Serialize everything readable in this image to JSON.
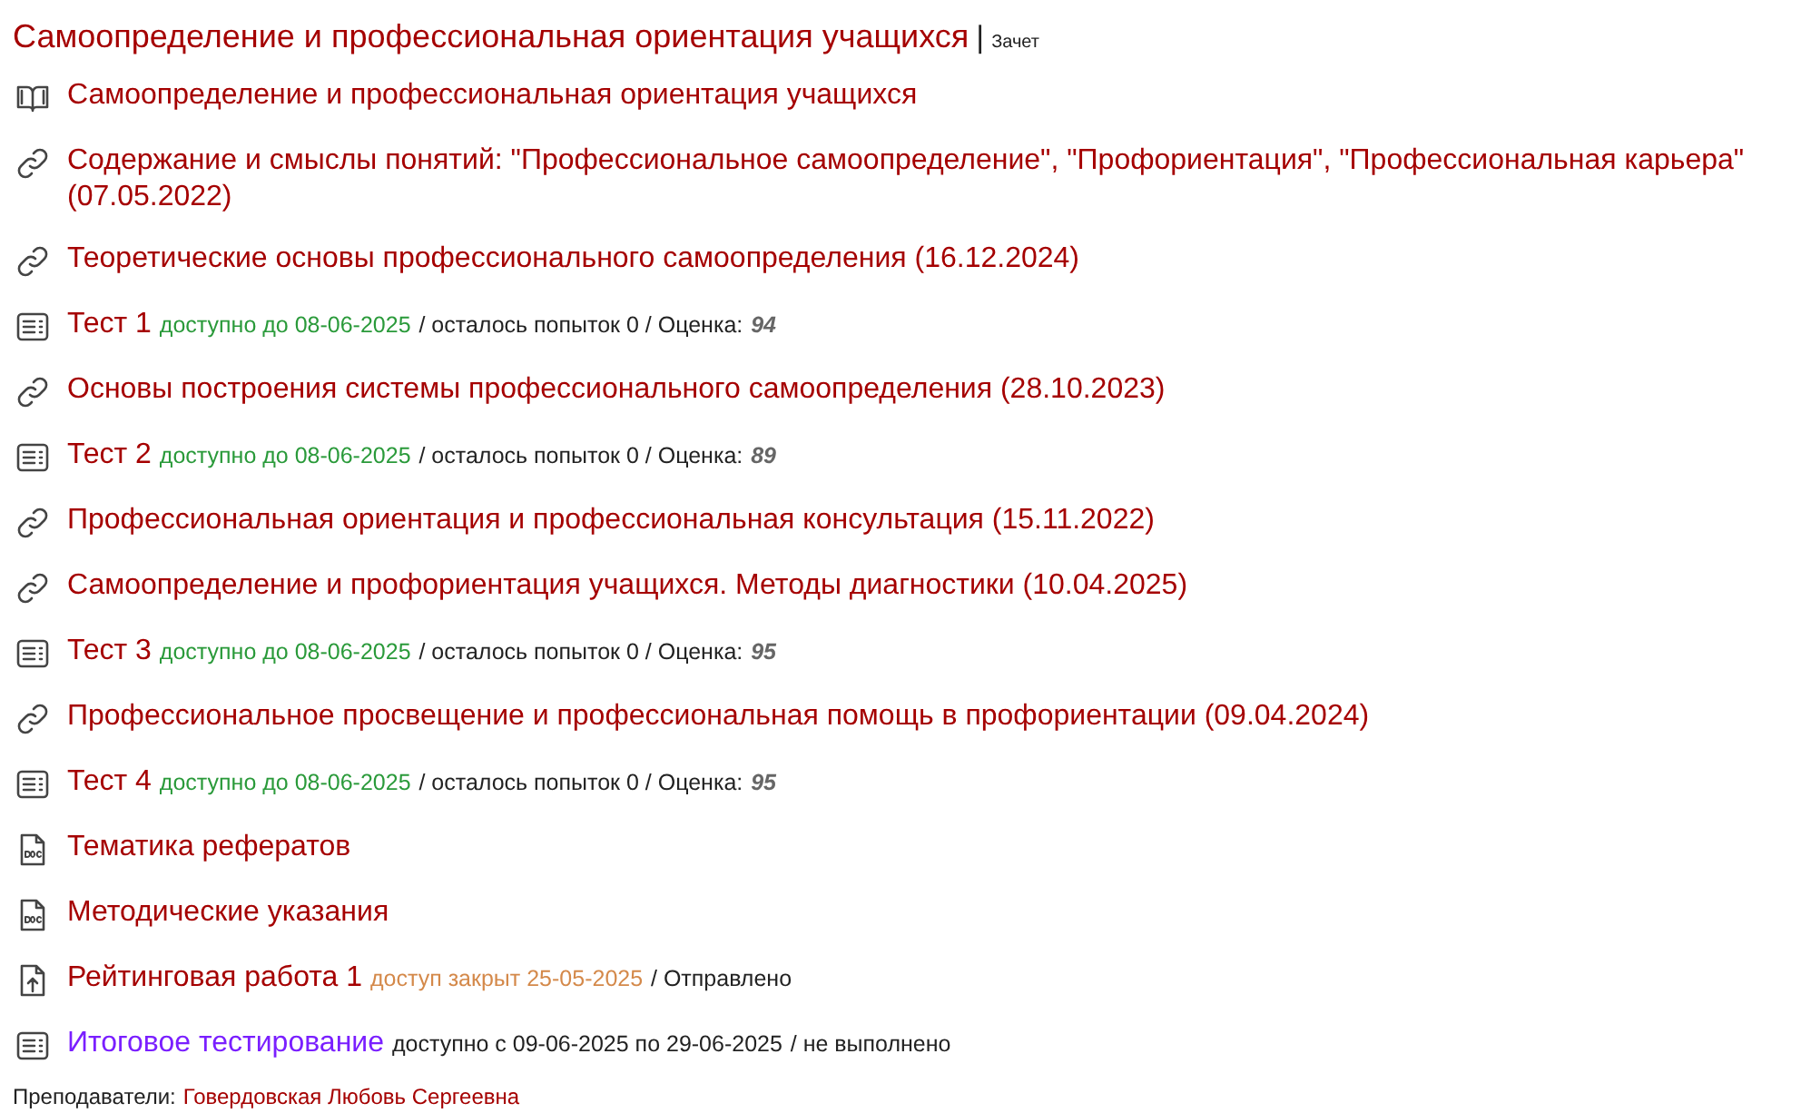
{
  "course": {
    "title": "Самоопределение и профессиональная ориентация учащихся",
    "separator": "|",
    "assessment": "Зачет"
  },
  "items": [
    {
      "kind": "book",
      "title": "Самоопределение и профессиональная ориентация учащихся",
      "color": "#a50000"
    },
    {
      "kind": "link",
      "title": "Содержание и смыслы понятий: \"Профессиональное самоопределение\", \"Профориентация\", \"Профессиональная карьера\" (07.05.2022)",
      "color": "#a50000"
    },
    {
      "kind": "link",
      "title": "Теоретические основы профессионального самоопределения (16.12.2024)",
      "color": "#a50000"
    },
    {
      "kind": "test",
      "title": "Тест 1",
      "color": "#a50000",
      "availability": {
        "kind": "open",
        "text": "доступно до 08-06-2025"
      },
      "details": "/ осталось попыток 0 / Оценка:",
      "grade": "94"
    },
    {
      "kind": "link",
      "title": "Основы построения системы профессионального самоопределения (28.10.2023)",
      "color": "#a50000"
    },
    {
      "kind": "test",
      "title": "Тест 2",
      "color": "#a50000",
      "availability": {
        "kind": "open",
        "text": "доступно до 08-06-2025"
      },
      "details": "/ осталось попыток 0 / Оценка:",
      "grade": "89"
    },
    {
      "kind": "link",
      "title": "Профессиональная ориентация и профессиональная консультация (15.11.2022)",
      "color": "#a50000"
    },
    {
      "kind": "link",
      "title": "Самоопределение и профориентация учащихся. Методы диагностики (10.04.2025)",
      "color": "#a50000"
    },
    {
      "kind": "test",
      "title": "Тест 3",
      "color": "#a50000",
      "availability": {
        "kind": "open",
        "text": "доступно до 08-06-2025"
      },
      "details": "/ осталось попыток 0 / Оценка:",
      "grade": "95"
    },
    {
      "kind": "link",
      "title": "Профессиональное просвещение и профессиональная помощь в профориентации (09.04.2024)",
      "color": "#a50000"
    },
    {
      "kind": "test",
      "title": "Тест 4",
      "color": "#a50000",
      "availability": {
        "kind": "open",
        "text": "доступно до 08-06-2025"
      },
      "details": "/ осталось попыток 0 / Оценка:",
      "grade": "95"
    },
    {
      "kind": "doc",
      "title": "Тематика рефератов",
      "color": "#a50000"
    },
    {
      "kind": "doc",
      "title": "Методические указания",
      "color": "#a50000"
    },
    {
      "kind": "upload",
      "title": "Рейтинговая работа 1",
      "color": "#a50000",
      "availability": {
        "kind": "closed",
        "text": "доступ закрыт 25-05-2025"
      },
      "details": "/ Отправлено"
    },
    {
      "kind": "test",
      "title": "Итоговое тестирование",
      "color": "#7a1fff",
      "availability": {
        "kind": "upcoming",
        "text": "доступно с 09-06-2025 по 29-06-2025"
      },
      "details": "/ не выполнено"
    }
  ],
  "footer": {
    "label": "Преподаватели:",
    "teachers": "Говердовская Любовь Сергеевна"
  }
}
